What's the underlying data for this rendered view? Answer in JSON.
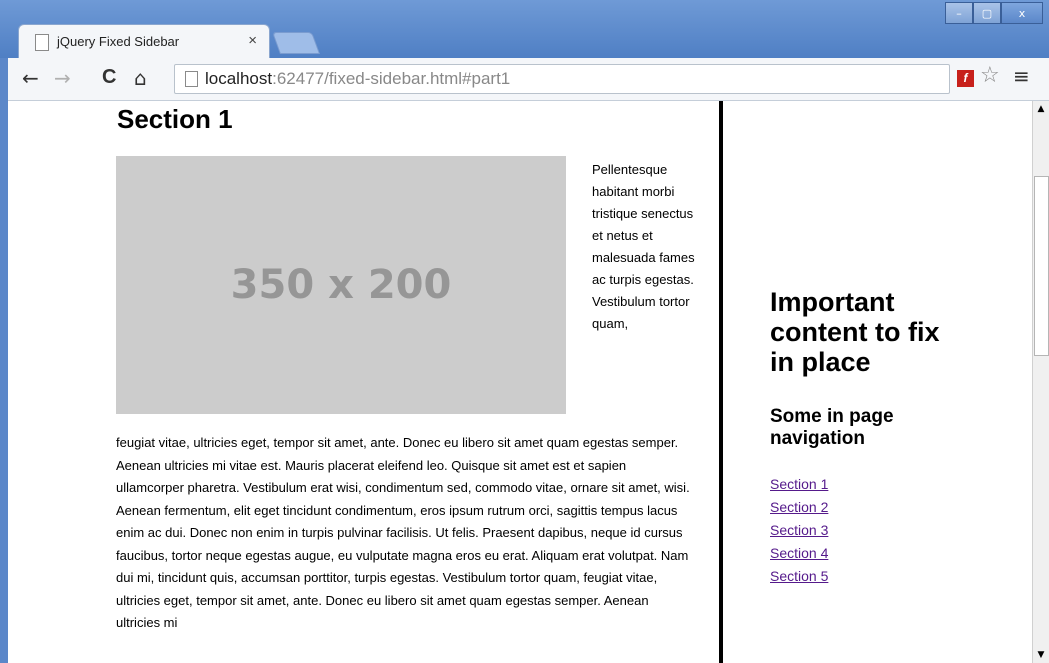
{
  "browser": {
    "tab_title": "jQuery Fixed Sidebar",
    "tab_close": "×",
    "url_host": "localhost",
    "url_rest": ":62477/fixed-sidebar.html#part1",
    "nav": {
      "back": "←",
      "forward": "→",
      "reload": "C",
      "home": "⌂",
      "menu": "≡",
      "star": "☆"
    },
    "window_controls": {
      "minimize": "–",
      "maximize": "▢",
      "close": "x"
    }
  },
  "main": {
    "section_title": "Section 1",
    "placeholder_text": "350 x 200",
    "side_text": "Pellentesque habitant morbi tristique senectus et netus et malesuada fames ac turpis egestas. Vestibulum tortor quam,",
    "body_text": "feugiat vitae, ultricies eget, tempor sit amet, ante. Donec eu libero sit amet quam egestas semper. Aenean ultricies mi vitae est. Mauris placerat eleifend leo. Quisque sit amet est et sapien ullamcorper pharetra. Vestibulum erat wisi, condimentum sed, commodo vitae, ornare sit amet, wisi. Aenean fermentum, elit eget tincidunt condimentum, eros ipsum rutrum orci, sagittis tempus lacus enim ac dui. Donec non enim in turpis pulvinar facilisis. Ut felis. Praesent dapibus, neque id cursus faucibus, tortor neque egestas augue, eu vulputate magna eros eu erat. Aliquam erat volutpat. Nam dui mi, tincidunt quis, accumsan porttitor, turpis egestas. Vestibulum tortor quam, feugiat vitae, ultricies eget, tempor sit amet, ante. Donec eu libero sit amet quam egestas semper. Aenean ultricies mi"
  },
  "sidebar": {
    "heading": "Important content to fix in place",
    "subheading": "Some in page navigation",
    "links": [
      "Section 1",
      "Section 2",
      "Section 3",
      "Section 4",
      "Section 5"
    ]
  },
  "scrollbar": {
    "up": "▲",
    "down": "▼"
  },
  "colors": {
    "link": "#551a8b",
    "placeholder_bg": "#cccccc",
    "divider": "#000000",
    "frame": "#5b87c9"
  }
}
